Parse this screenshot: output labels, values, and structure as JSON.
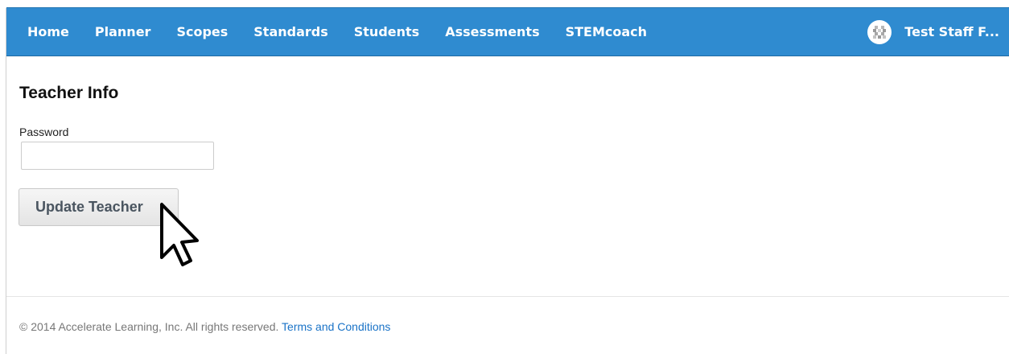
{
  "navbar": {
    "background": "#2f8bd0",
    "items": [
      {
        "label": "Home"
      },
      {
        "label": "Planner"
      },
      {
        "label": "Scopes"
      },
      {
        "label": "Standards"
      },
      {
        "label": "Students"
      },
      {
        "label": "Assessments"
      },
      {
        "label": "STEMcoach"
      }
    ],
    "user": {
      "avatar_icon": "avatar-icon",
      "name": "Test Staff F..."
    }
  },
  "main": {
    "title": "Teacher Info",
    "password": {
      "label": "Password",
      "value": "",
      "placeholder": ""
    },
    "update_button_label": "Update Teacher"
  },
  "footer": {
    "copyright": "© 2014 Accelerate Learning, Inc. All rights reserved.",
    "terms_link": "Terms and Conditions",
    "link_color": "#1a73c7"
  }
}
